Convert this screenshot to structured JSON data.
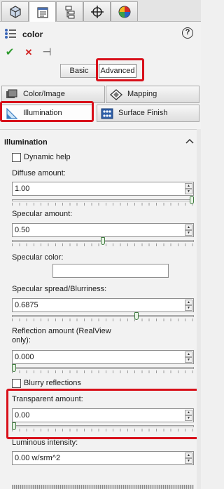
{
  "top_tabs": [
    {
      "icon": "feature-manager-icon"
    },
    {
      "icon": "property-manager-icon"
    },
    {
      "icon": "configuration-manager-icon"
    },
    {
      "icon": "dimxpert-manager-icon"
    },
    {
      "icon": "appearances-icon"
    }
  ],
  "header": {
    "title": "color",
    "actions": {
      "ok": "✔",
      "cancel": "✕",
      "pin": "⊣"
    }
  },
  "mode": {
    "basic": "Basic",
    "advanced": "Advanced"
  },
  "subtabs": {
    "color_image": "Color/Image",
    "mapping": "Mapping",
    "illumination": "Illumination",
    "surface_finish": "Surface Finish"
  },
  "illumination": {
    "heading": "Illumination",
    "dynamic_help": "Dynamic help",
    "diffuse": {
      "label": "Diffuse amount:",
      "value": "1.00",
      "level": 1.0
    },
    "specular": {
      "label": "Specular amount:",
      "value": "0.50",
      "level": 0.5
    },
    "specular_color": {
      "label": "Specular color:",
      "color": "#ffffff"
    },
    "spread": {
      "label": "Specular spread/Blurriness:",
      "value": "0.6875",
      "level": 0.6875
    },
    "reflection": {
      "label_line1": "Reflection amount (RealView",
      "label_line2": "only):",
      "value": "0.000",
      "level": 0.0
    },
    "blurry": "Blurry reflections",
    "transparent": {
      "label": "Transparent amount:",
      "value": "0.00",
      "level": 0.0
    },
    "luminous": {
      "label": "Luminous intensity:",
      "value": "0.00 w/srm^2"
    }
  },
  "colors": {
    "highlight": "#d8101a",
    "ok": "#2e9b2e",
    "cancel": "#d02020"
  }
}
